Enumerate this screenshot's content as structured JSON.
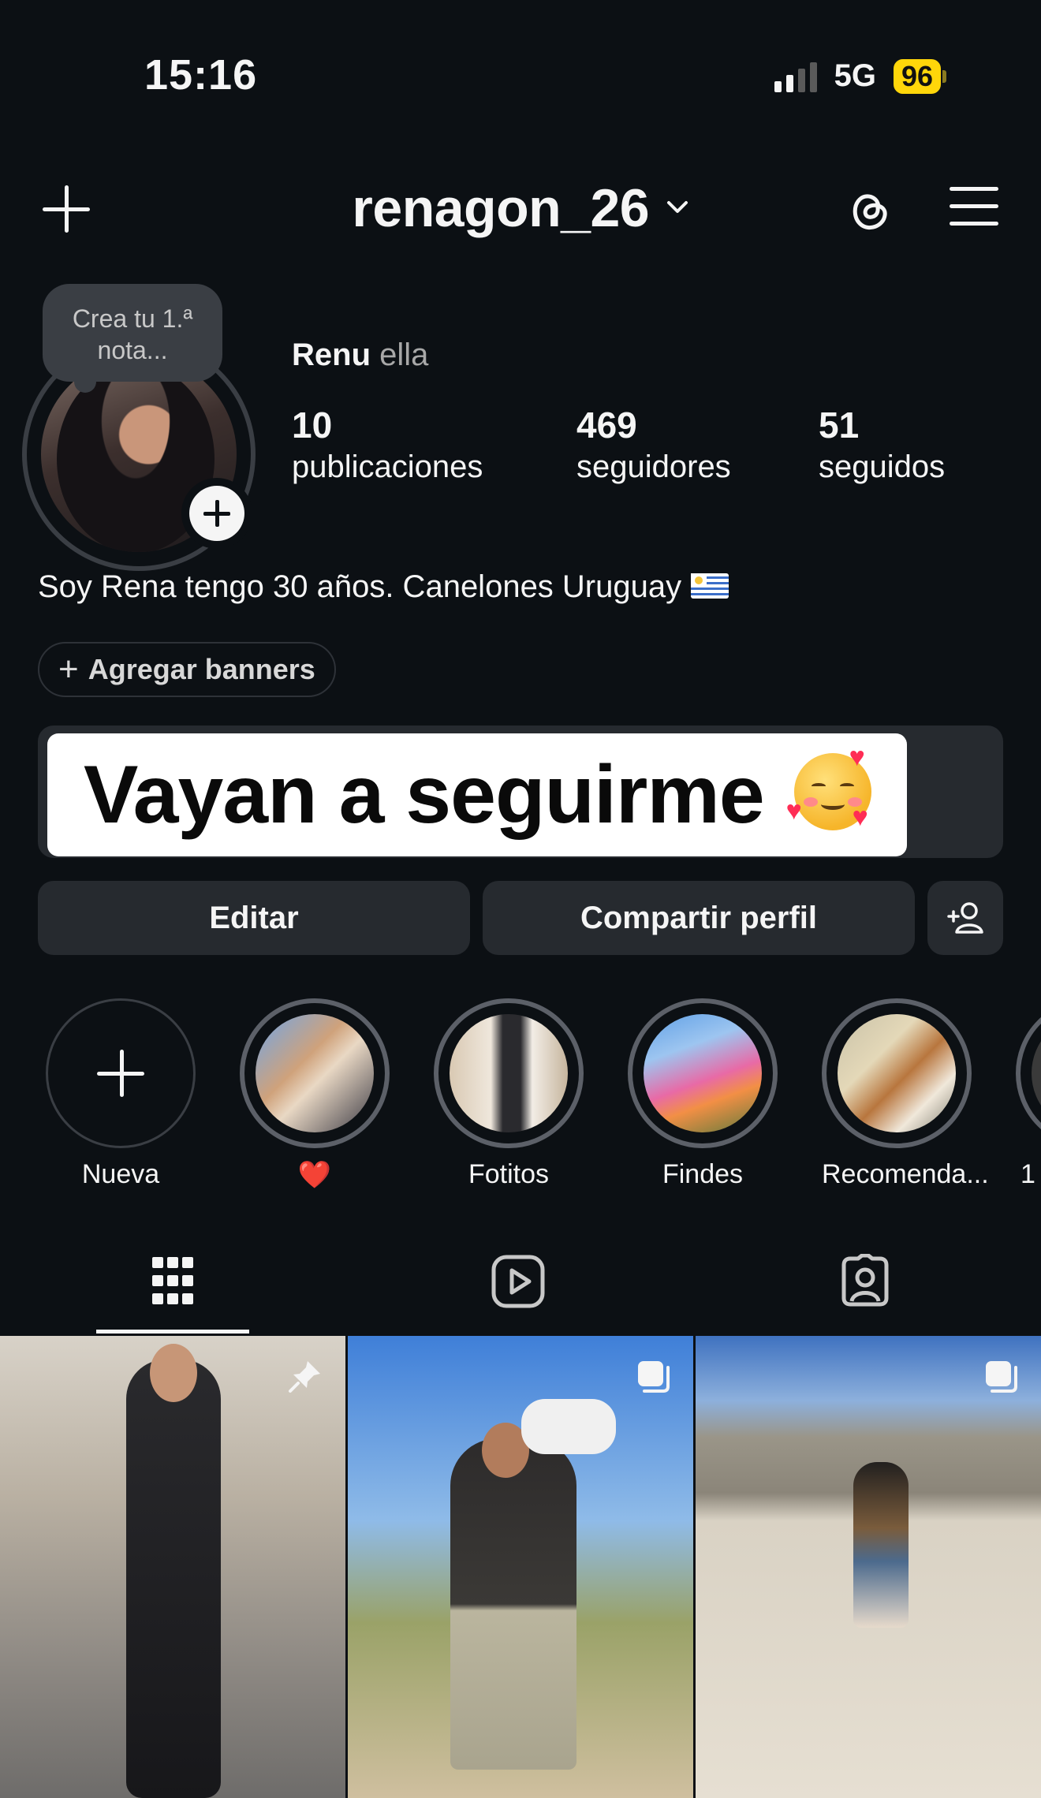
{
  "status_bar": {
    "time": "15:16",
    "network": "5G",
    "battery": "96"
  },
  "header": {
    "username": "renagon_26",
    "icons": [
      "plus-icon",
      "chevron-down-icon",
      "threads-icon",
      "menu-icon"
    ]
  },
  "profile": {
    "note": "Crea tu 1.ª nota...",
    "name": "Renu",
    "pronouns": "ella",
    "stats": [
      {
        "value": "10",
        "label": "publicaciones"
      },
      {
        "value": "469",
        "label": "seguidores"
      },
      {
        "value": "51",
        "label": "seguidos"
      }
    ],
    "bio": "Soy Rena tengo 30 años. Canelones Uruguay",
    "banner_button": "Agregar banners",
    "story_text": "Vayan a seguirme"
  },
  "actions": {
    "edit": "Editar",
    "share": "Compartir perfil",
    "add_person_icon": "add-person-icon"
  },
  "highlights": [
    {
      "label": "Nueva"
    },
    {
      "label": "❤️"
    },
    {
      "label": "Fotitos"
    },
    {
      "label": "Findes"
    },
    {
      "label": "Recomenda..."
    },
    {
      "label": "1"
    }
  ],
  "tabs": [
    "grid-icon",
    "reels-icon",
    "tagged-icon"
  ],
  "colors": {
    "background": "#0c1014",
    "button": "#262a2f",
    "battery": "#ffd60a",
    "text": "#f5f5f5"
  }
}
